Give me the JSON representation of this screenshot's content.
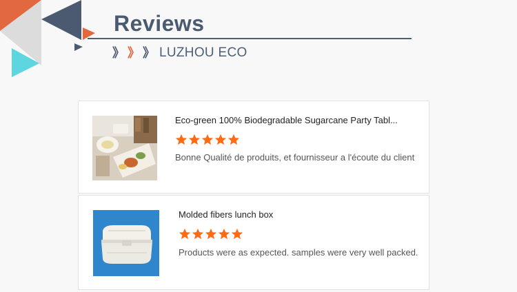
{
  "section": {
    "title": "Reviews",
    "subtitle": "LUZHOU ECO",
    "chevrons": [
      "》",
      "》",
      "》"
    ]
  },
  "colors": {
    "accent_orange": "#e0673d",
    "slate": "#4a5a70",
    "cyan": "#5dd6e0",
    "star": "#ff6a13"
  },
  "reviews": [
    {
      "product_name": "Eco-green 100% Biodegradable Sugarcane Party Tabl...",
      "rating": 5,
      "comment": "Bonne Qualité de produits, et fournisseur a l'écoute du client",
      "image_icon": "sugarcane-tableware-photo"
    },
    {
      "product_name": "Molded fibers lunch box",
      "rating": 5,
      "comment": "Products were as expected. samples were very well packed.",
      "image_icon": "lunch-box-photo"
    }
  ]
}
